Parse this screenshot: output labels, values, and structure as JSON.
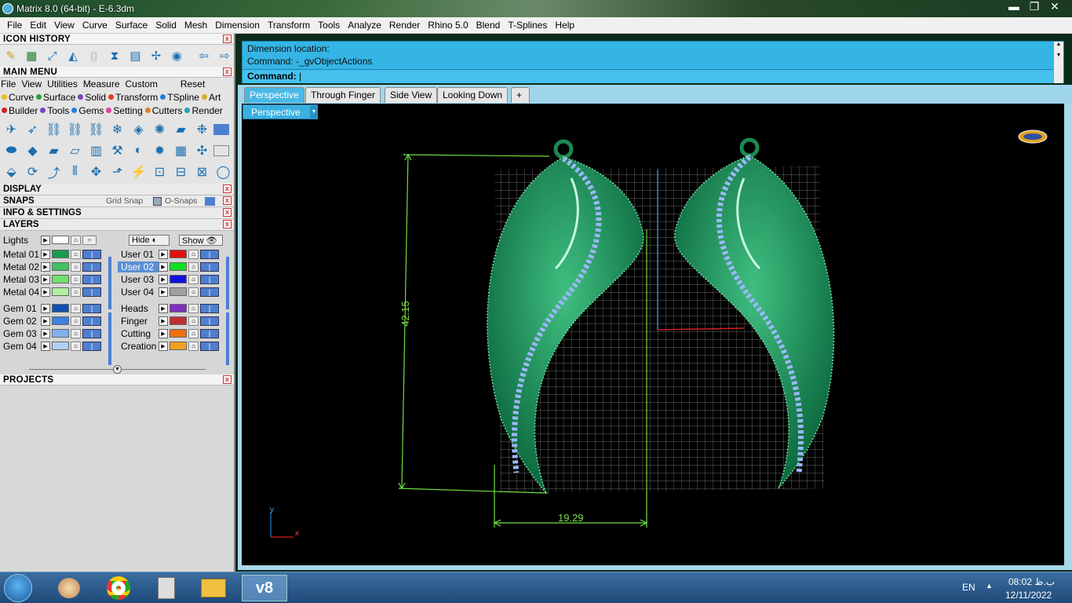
{
  "window": {
    "title": "Matrix 8.0 (64-bit) - E-6.3dm",
    "minimize": "▬",
    "maximize": "❐",
    "close": "✕"
  },
  "menu": [
    "File",
    "Edit",
    "View",
    "Curve",
    "Surface",
    "Solid",
    "Mesh",
    "Dimension",
    "Transform",
    "Tools",
    "Analyze",
    "Render",
    "Rhino 5.0",
    "Blend",
    "T-Splines",
    "Help"
  ],
  "left_panel": {
    "icon_history_title": "ICON HISTORY",
    "main_menu_title": "MAIN MENU",
    "main_menu_items": [
      "File",
      "View",
      "Utilities",
      "Measure",
      "Custom"
    ],
    "reset": "Reset",
    "categories_row1": [
      {
        "label": "Curve",
        "color": "#e8c020"
      },
      {
        "label": "Surface",
        "color": "#30a040"
      },
      {
        "label": "Solid",
        "color": "#8040c0"
      },
      {
        "label": "Transform",
        "color": "#e04020"
      },
      {
        "label": "TSpline",
        "color": "#2080e0"
      },
      {
        "label": "Art",
        "color": "#d0b020"
      }
    ],
    "categories_row2": [
      {
        "label": "Builder",
        "color": "#d02020"
      },
      {
        "label": "Tools",
        "color": "#8040c0"
      },
      {
        "label": "Gems",
        "color": "#2080e0"
      },
      {
        "label": "Setting",
        "color": "#e040a0"
      },
      {
        "label": "Cutters",
        "color": "#e08020"
      },
      {
        "label": "Render",
        "color": "#20a0c0"
      }
    ],
    "display_title": "DISPLAY",
    "snaps_title": "SNAPS",
    "grid_snap": "Grid Snap",
    "o_snaps": "O-Snaps",
    "info_title": "INFO & SETTINGS",
    "layers_title": "LAYERS",
    "lights": "Lights",
    "hide": "Hide",
    "show": "Show",
    "layers_left": [
      {
        "name": "Metal 01",
        "color": "#1a9a50"
      },
      {
        "name": "Metal 02",
        "color": "#40c060"
      },
      {
        "name": "Metal 03",
        "color": "#70e070"
      },
      {
        "name": "Metal 04",
        "color": "#b0f0a0"
      },
      {
        "name": "Gem 01",
        "color": "#1050b0"
      },
      {
        "name": "Gem 02",
        "color": "#4080e0"
      },
      {
        "name": "Gem 03",
        "color": "#80b0f0"
      },
      {
        "name": "Gem 04",
        "color": "#b0d0f8"
      }
    ],
    "layers_right": [
      {
        "name": "User 01",
        "color": "#e01010"
      },
      {
        "name": "User 02",
        "color": "#10e020"
      },
      {
        "name": "User 03",
        "color": "#1010e0"
      },
      {
        "name": "User 04",
        "color": "#a0a0a0"
      },
      {
        "name": "Heads",
        "color": "#8030c0"
      },
      {
        "name": "Finger",
        "color": "#c03030"
      },
      {
        "name": "Cutting",
        "color": "#f07010"
      },
      {
        "name": "Creation",
        "color": "#f0a020"
      }
    ],
    "projects_title": "PROJECTS"
  },
  "command": {
    "line1": "Dimension location:",
    "line2": "Command: -_gvObjectActions",
    "prompt": "Command:"
  },
  "tabs": [
    "Perspective",
    "Through Finger",
    "Side View",
    "Looking Down",
    "+"
  ],
  "viewport": {
    "label": "Perspective",
    "dim_vertical": "42.15",
    "dim_horizontal": "19.29",
    "axis_y": "y",
    "axis_x": "x"
  },
  "taskbar": {
    "lang": "EN",
    "time": "08:02 ب.ظ",
    "date": "12/11/2022",
    "apps": [
      "start",
      "paint",
      "chrome",
      "calculator",
      "explorer",
      "matrix"
    ]
  }
}
